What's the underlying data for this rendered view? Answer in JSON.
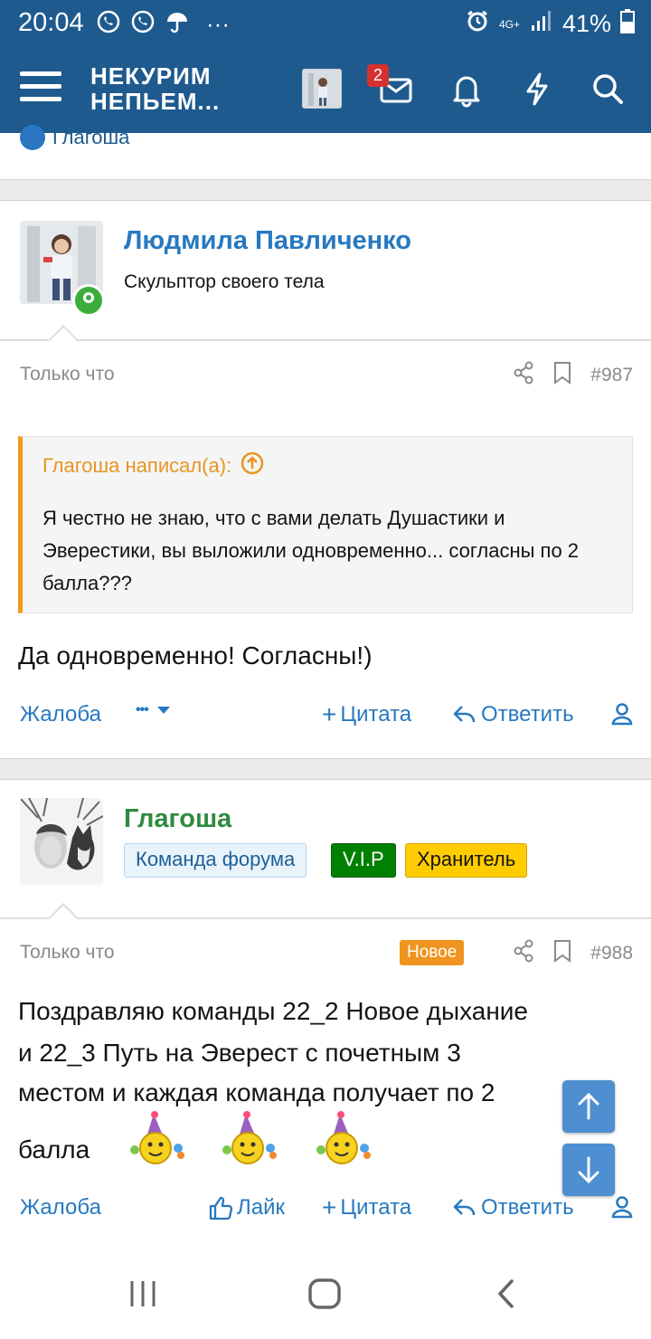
{
  "status_bar": {
    "time": "20:04",
    "network": "4G+",
    "battery": "41%"
  },
  "header": {
    "logo_line1": "НЕКУРИМ",
    "logo_line2": "НЕПЬЕМ...",
    "messages_badge": "2"
  },
  "previous_post_peek": {
    "label": "Глагоша"
  },
  "post1": {
    "author": "Людмила Павличенко",
    "user_title": "Скульптор своего тела",
    "time": "Только что",
    "number": "#987",
    "quote_author": "Глагоша написал(а):",
    "quote_text": "Я честно не знаю, что с вами делать Душастики и Эверестики, вы выложили одновременно... согласны по 2 балла???",
    "message": "Да одновременно! Согласны!)",
    "actions": {
      "report": "Жалоба",
      "more": "•••",
      "quote": "Цитата",
      "reply": "Ответить"
    }
  },
  "post2": {
    "author": "Глагоша",
    "banners": [
      "Команда форума",
      "V.I.P",
      "Хранитель"
    ],
    "time": "Только что",
    "new_label": "Новое",
    "number": "#988",
    "message_line1": "Поздравляю команды 22_2 Новое дыхание",
    "message_line2": "и 22_3 Путь на Эверест с почетным 3",
    "message_line3": "местом и каждая команда получает по 2",
    "message_line4": "балла",
    "actions": {
      "report": "Жалоба",
      "like": "Лайк",
      "quote": "Цитата",
      "reply": "Ответить"
    }
  },
  "colors": {
    "header": "#1e5a8e",
    "link": "#2779c0",
    "quote_accent": "#f29a1b",
    "staff_green": "#2f8a3e",
    "online": "#3cad3c"
  }
}
